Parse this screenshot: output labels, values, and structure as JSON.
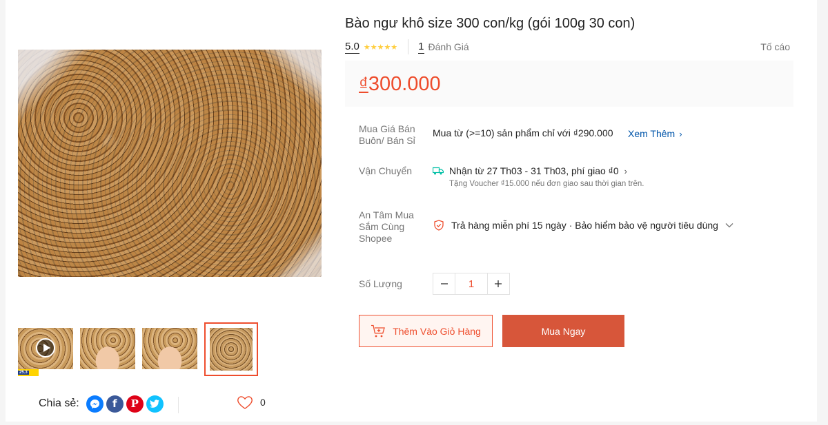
{
  "product": {
    "title": "Bào ngư khô size 300 con/kg (gói 100g 30 con)",
    "rating": "5.0",
    "stars": "★★★★★",
    "review_count": "1",
    "review_label": "Đánh Giá",
    "report_label": "Tố cáo",
    "price_currency": "₫",
    "price_value": "300.000"
  },
  "details": {
    "wholesale_label": "Mua Giá Bán Buôn/ Bán Sỉ",
    "wholesale_text": "Mua từ (>=10) sản phẩm chỉ với ₫290.000",
    "see_more": "Xem Thêm",
    "shipping_label": "Vận Chuyển",
    "shipping_text": "Nhận từ 27 Th03 - 31 Th03, phí giao ₫0",
    "shipping_sub": "Tặng Voucher ₫15.000 nếu đơn giao sau thời gian trên.",
    "guarantee_label": "An Tâm Mua Sắm Cùng Shopee",
    "guarantee_text": "Trả hàng miễn phí 15 ngày · Bảo hiểm bảo vệ người tiêu dùng",
    "quantity_label": "Số Lượng",
    "quantity_value": "1"
  },
  "actions": {
    "add_to_cart": "Thêm Vào Giỏ Hàng",
    "buy_now": "Mua Ngay"
  },
  "gallery": {
    "badge_date": "25.3",
    "selected_index": 3
  },
  "share": {
    "label": "Chia sẻ:",
    "networks": [
      "messenger-icon",
      "facebook-icon",
      "pinterest-icon",
      "twitter-icon"
    ],
    "like_count": "0"
  },
  "colors": {
    "accent": "#ee4d2d",
    "buy_button": "#d7563a",
    "link": "#0055aa",
    "stars": "#ffce3d"
  }
}
